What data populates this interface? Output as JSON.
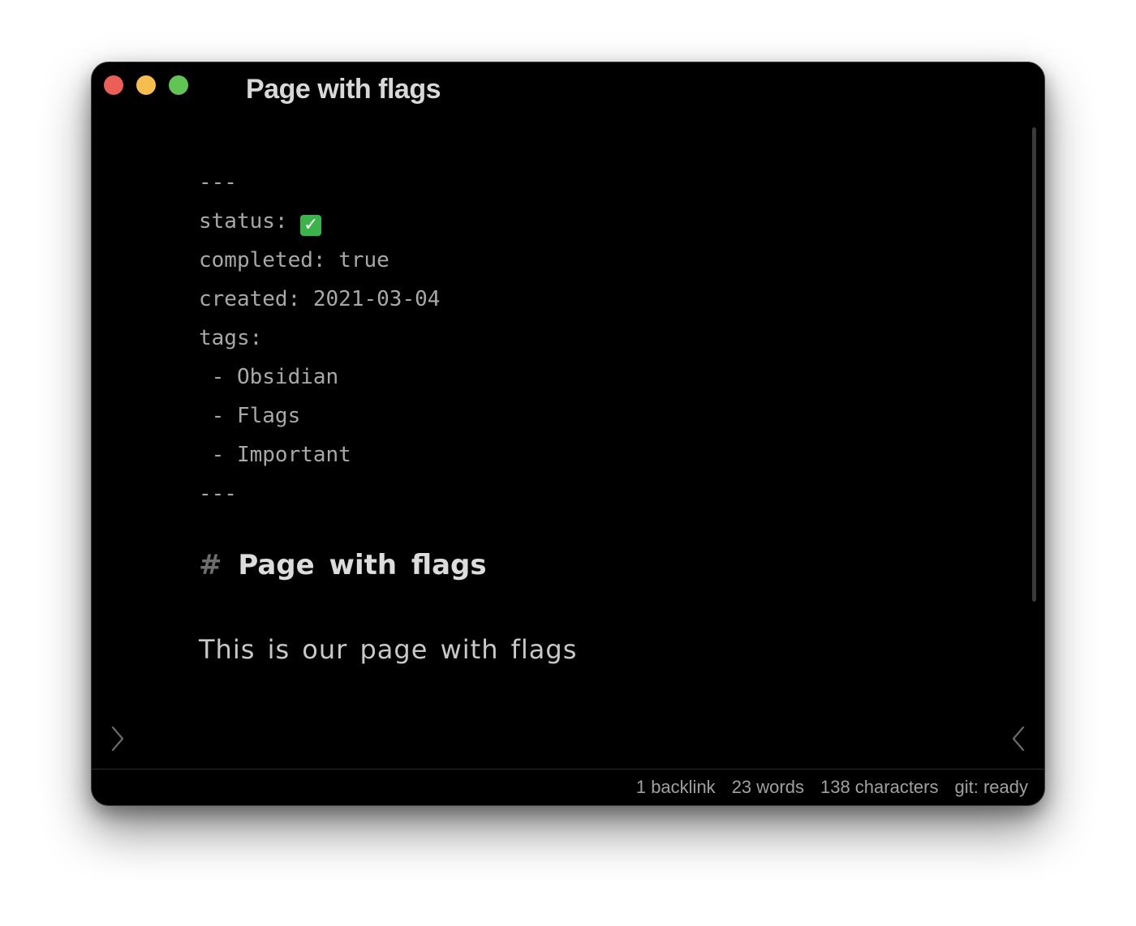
{
  "window": {
    "title": "Page with flags",
    "traffic_lights": {
      "close_color": "#ec5f57",
      "minimize_color": "#f5be4f",
      "maximize_color": "#61c554"
    }
  },
  "frontmatter": {
    "open_delim": "---",
    "status_key": "status: ",
    "status_icon": "white-heavy-check-mark-icon",
    "status_glyph": "✓",
    "completed_line": "completed: true",
    "created_line": "created: 2021-03-04",
    "tags_line": "tags:",
    "tag_items": [
      " - Obsidian",
      " - Flags",
      " - Important"
    ],
    "close_delim": "---"
  },
  "content": {
    "heading_marker": "#",
    "heading_text": "Page with flags",
    "paragraph": "This is our page with flags"
  },
  "statusbar": {
    "backlinks": "1 backlink",
    "words": "23 words",
    "characters": "138 characters",
    "git": "git: ready"
  },
  "colors": {
    "background": "#000000",
    "check_green": "#3bb34a"
  }
}
